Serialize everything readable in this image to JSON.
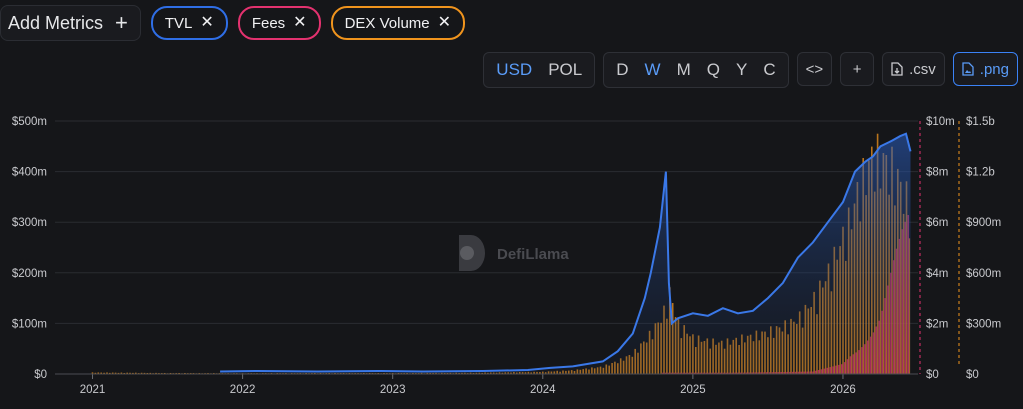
{
  "top_bar": {
    "add_metrics_label": "Add Metrics",
    "chips": [
      {
        "label": "TVL",
        "color": "#2f6ee6"
      },
      {
        "label": "Fees",
        "color": "#e3326f"
      },
      {
        "label": "DEX Volume",
        "color": "#f0941d"
      }
    ]
  },
  "controls": {
    "currency": [
      {
        "label": "USD",
        "active": true
      },
      {
        "label": "POL",
        "active": false
      }
    ],
    "period": [
      {
        "label": "D",
        "active": false
      },
      {
        "label": "W",
        "active": true
      },
      {
        "label": "M",
        "active": false
      },
      {
        "label": "Q",
        "active": false
      },
      {
        "label": "Y",
        "active": false
      },
      {
        "label": "C",
        "active": false
      }
    ],
    "embed_label": "<>",
    "add_label": "+",
    "csv_label": ".csv",
    "png_label": ".png"
  },
  "watermark": "DefiLlama",
  "chart_data": {
    "type": "line",
    "x_ticks": [
      "2021",
      "2022",
      "2023",
      "2024",
      "2025",
      "2026"
    ],
    "x_range": [
      2020.75,
      2026.5
    ],
    "axes": {
      "left": {
        "ticks": [
          "$0",
          "$100m",
          "$200m",
          "$300m",
          "$400m",
          "$500m"
        ],
        "range": [
          0,
          500
        ],
        "unit": "m"
      },
      "right1": {
        "ticks": [
          "$0",
          "$2m",
          "$4m",
          "$6m",
          "$8m",
          "$10m"
        ],
        "range": [
          0,
          10
        ],
        "unit": "m"
      },
      "right2": {
        "ticks": [
          "$0",
          "$300m",
          "$600m",
          "$900m",
          "$1.2b",
          "$1.5b"
        ],
        "range": [
          0,
          1500
        ],
        "unit": "m"
      }
    },
    "series": [
      {
        "name": "TVL",
        "axis": "left",
        "color": "#3a78e8",
        "kind": "area",
        "x": [
          2021.85,
          2022.1,
          2022.5,
          2022.9,
          2023.2,
          2023.6,
          2023.9,
          2024.05,
          2024.2,
          2024.4,
          2024.5,
          2024.6,
          2024.68,
          2024.72,
          2024.78,
          2024.82,
          2024.84,
          2024.86,
          2024.9,
          2025.0,
          2025.1,
          2025.2,
          2025.3,
          2025.4,
          2025.5,
          2025.6,
          2025.7,
          2025.8,
          2025.9,
          2026.0,
          2026.08,
          2026.15,
          2026.2,
          2026.25,
          2026.32,
          2026.38,
          2026.42,
          2026.45
        ],
        "values": [
          5,
          6,
          5,
          6,
          5,
          6,
          8,
          12,
          15,
          25,
          45,
          80,
          150,
          200,
          290,
          400,
          180,
          100,
          110,
          120,
          115,
          130,
          120,
          125,
          150,
          180,
          230,
          260,
          300,
          340,
          400,
          420,
          430,
          450,
          460,
          470,
          475,
          440
        ]
      },
      {
        "name": "DEX Volume",
        "axis": "right2",
        "color": "#f0941d",
        "kind": "bar",
        "x": [
          2021.0,
          2021.5,
          2022.0,
          2022.5,
          2023.0,
          2023.5,
          2024.0,
          2024.2,
          2024.4,
          2024.5,
          2024.6,
          2024.7,
          2024.75,
          2024.8,
          2024.85,
          2024.9,
          2025.0,
          2025.1,
          2025.2,
          2025.3,
          2025.4,
          2025.5,
          2025.6,
          2025.7,
          2025.8,
          2025.9,
          2026.0,
          2026.05,
          2026.1,
          2026.15,
          2026.2,
          2026.25,
          2026.3,
          2026.35,
          2026.4,
          2026.45
        ],
        "values": [
          8,
          5,
          4,
          5,
          5,
          6,
          12,
          20,
          40,
          70,
          110,
          200,
          260,
          320,
          450,
          280,
          200,
          180,
          170,
          190,
          210,
          230,
          260,
          300,
          400,
          550,
          750,
          850,
          1000,
          1100,
          1200,
          1180,
          1150,
          1100,
          1000,
          900
        ]
      },
      {
        "name": "Fees",
        "axis": "right1",
        "color": "#e3326f",
        "kind": "bar",
        "x": [
          2024.8,
          2024.9,
          2025.0,
          2025.2,
          2025.4,
          2025.6,
          2025.8,
          2026.0,
          2026.05,
          2026.1,
          2026.15,
          2026.2,
          2026.25,
          2026.3,
          2026.35,
          2026.4,
          2026.45
        ],
        "values": [
          0.05,
          0.05,
          0.05,
          0.05,
          0.06,
          0.08,
          0.1,
          0.4,
          0.7,
          0.9,
          1.2,
          1.6,
          2.2,
          3.5,
          4.8,
          5.8,
          6.5
        ]
      }
    ]
  }
}
